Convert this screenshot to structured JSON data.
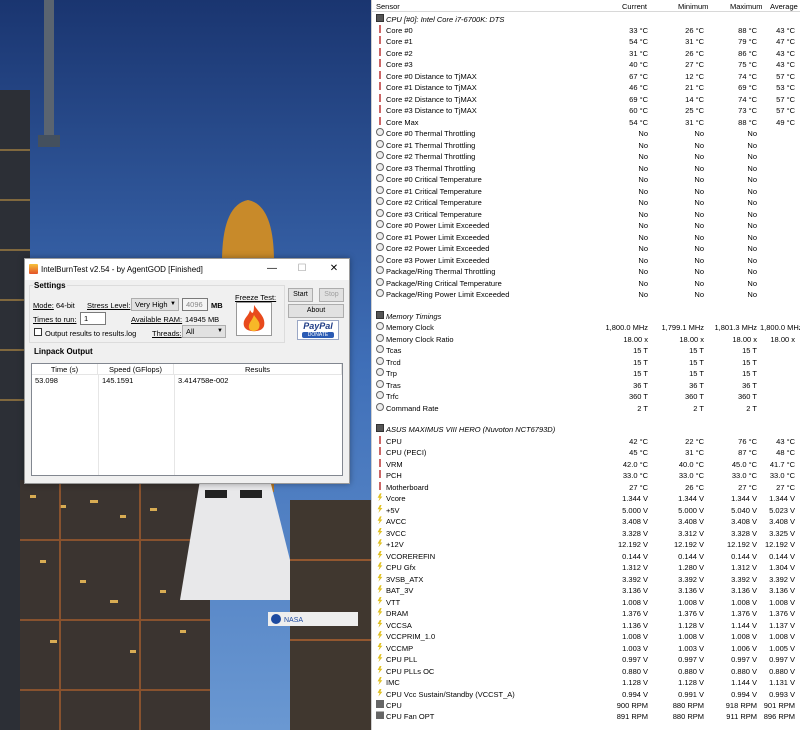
{
  "sensor_panel": {
    "headers": {
      "sensor": "Sensor",
      "current": "Current",
      "minimum": "Minimum",
      "maximum": "Maximum",
      "average": "Average"
    },
    "rows": [
      {
        "type": "group",
        "name": "CPU [#0]: Intel Core i7-6700K: DTS"
      },
      {
        "icon": "thermometer-icon",
        "name": "Core #0",
        "cur": "33 °C",
        "min": "26 °C",
        "max": "88 °C",
        "avg": "43 °C"
      },
      {
        "icon": "thermometer-icon",
        "name": "Core #1",
        "cur": "54 °C",
        "min": "31 °C",
        "max": "79 °C",
        "avg": "47 °C"
      },
      {
        "icon": "thermometer-icon",
        "name": "Core #2",
        "cur": "31 °C",
        "min": "26 °C",
        "max": "86 °C",
        "avg": "43 °C"
      },
      {
        "icon": "thermometer-icon",
        "name": "Core #3",
        "cur": "40 °C",
        "min": "27 °C",
        "max": "75 °C",
        "avg": "43 °C"
      },
      {
        "icon": "thermometer-icon",
        "name": "Core #0 Distance to TjMAX",
        "cur": "67 °C",
        "min": "12 °C",
        "max": "74 °C",
        "avg": "57 °C"
      },
      {
        "icon": "thermometer-icon",
        "name": "Core #1 Distance to TjMAX",
        "cur": "46 °C",
        "min": "21 °C",
        "max": "69 °C",
        "avg": "53 °C"
      },
      {
        "icon": "thermometer-icon",
        "name": "Core #2 Distance to TjMAX",
        "cur": "69 °C",
        "min": "14 °C",
        "max": "74 °C",
        "avg": "57 °C"
      },
      {
        "icon": "thermometer-icon",
        "name": "Core #3 Distance to TjMAX",
        "cur": "60 °C",
        "min": "25 °C",
        "max": "73 °C",
        "avg": "57 °C"
      },
      {
        "icon": "thermometer-icon",
        "name": "Core Max",
        "cur": "54 °C",
        "min": "31 °C",
        "max": "88 °C",
        "avg": "49 °C"
      },
      {
        "icon": "clock-icon",
        "name": "Core #0 Thermal Throttling",
        "cur": "No",
        "min": "No",
        "max": "No",
        "avg": ""
      },
      {
        "icon": "clock-icon",
        "name": "Core #1 Thermal Throttling",
        "cur": "No",
        "min": "No",
        "max": "No",
        "avg": ""
      },
      {
        "icon": "clock-icon",
        "name": "Core #2 Thermal Throttling",
        "cur": "No",
        "min": "No",
        "max": "No",
        "avg": ""
      },
      {
        "icon": "clock-icon",
        "name": "Core #3 Thermal Throttling",
        "cur": "No",
        "min": "No",
        "max": "No",
        "avg": ""
      },
      {
        "icon": "clock-icon",
        "name": "Core #0 Critical Temperature",
        "cur": "No",
        "min": "No",
        "max": "No",
        "avg": ""
      },
      {
        "icon": "clock-icon",
        "name": "Core #1 Critical Temperature",
        "cur": "No",
        "min": "No",
        "max": "No",
        "avg": ""
      },
      {
        "icon": "clock-icon",
        "name": "Core #2 Critical Temperature",
        "cur": "No",
        "min": "No",
        "max": "No",
        "avg": ""
      },
      {
        "icon": "clock-icon",
        "name": "Core #3 Critical Temperature",
        "cur": "No",
        "min": "No",
        "max": "No",
        "avg": ""
      },
      {
        "icon": "clock-icon",
        "name": "Core #0 Power Limit Exceeded",
        "cur": "No",
        "min": "No",
        "max": "No",
        "avg": ""
      },
      {
        "icon": "clock-icon",
        "name": "Core #1 Power Limit Exceeded",
        "cur": "No",
        "min": "No",
        "max": "No",
        "avg": ""
      },
      {
        "icon": "clock-icon",
        "name": "Core #2 Power Limit Exceeded",
        "cur": "No",
        "min": "No",
        "max": "No",
        "avg": ""
      },
      {
        "icon": "clock-icon",
        "name": "Core #3 Power Limit Exceeded",
        "cur": "No",
        "min": "No",
        "max": "No",
        "avg": ""
      },
      {
        "icon": "clock-icon",
        "name": "Package/Ring Thermal Throttling",
        "cur": "No",
        "min": "No",
        "max": "No",
        "avg": ""
      },
      {
        "icon": "clock-icon",
        "name": "Package/Ring Critical Temperature",
        "cur": "No",
        "min": "No",
        "max": "No",
        "avg": ""
      },
      {
        "icon": "clock-icon",
        "name": "Package/Ring Power Limit Exceeded",
        "cur": "No",
        "min": "No",
        "max": "No",
        "avg": ""
      },
      {
        "type": "spacer"
      },
      {
        "type": "group",
        "name": "Memory Timings"
      },
      {
        "icon": "clock-icon",
        "name": "Memory Clock",
        "cur": "1,800.0 MHz",
        "min": "1,799.1 MHz",
        "max": "1,801.3 MHz",
        "avg": "1,800.0 MHz"
      },
      {
        "icon": "clock-icon",
        "name": "Memory Clock Ratio",
        "cur": "18.00 x",
        "min": "18.00 x",
        "max": "18.00 x",
        "avg": "18.00 x"
      },
      {
        "icon": "clock-icon",
        "name": "Tcas",
        "cur": "15 T",
        "min": "15 T",
        "max": "15 T",
        "avg": ""
      },
      {
        "icon": "clock-icon",
        "name": "Trcd",
        "cur": "15 T",
        "min": "15 T",
        "max": "15 T",
        "avg": ""
      },
      {
        "icon": "clock-icon",
        "name": "Trp",
        "cur": "15 T",
        "min": "15 T",
        "max": "15 T",
        "avg": ""
      },
      {
        "icon": "clock-icon",
        "name": "Tras",
        "cur": "36 T",
        "min": "36 T",
        "max": "36 T",
        "avg": ""
      },
      {
        "icon": "clock-icon",
        "name": "Trfc",
        "cur": "360 T",
        "min": "360 T",
        "max": "360 T",
        "avg": ""
      },
      {
        "icon": "clock-icon",
        "name": "Command Rate",
        "cur": "2 T",
        "min": "2 T",
        "max": "2 T",
        "avg": ""
      },
      {
        "type": "spacer"
      },
      {
        "type": "group",
        "name": "ASUS MAXIMUS VIII HERO (Nuvoton NCT6793D)"
      },
      {
        "icon": "thermometer-icon",
        "name": "CPU",
        "cur": "42 °C",
        "min": "22 °C",
        "max": "76 °C",
        "avg": "43 °C"
      },
      {
        "icon": "thermometer-icon",
        "name": "CPU (PECI)",
        "cur": "45 °C",
        "min": "31 °C",
        "max": "87 °C",
        "avg": "48 °C"
      },
      {
        "icon": "thermometer-icon",
        "name": "VRM",
        "cur": "42.0 °C",
        "min": "40.0 °C",
        "max": "45.0 °C",
        "avg": "41.7 °C"
      },
      {
        "icon": "thermometer-icon",
        "name": "PCH",
        "cur": "33.0 °C",
        "min": "33.0 °C",
        "max": "33.0 °C",
        "avg": "33.0 °C"
      },
      {
        "icon": "thermometer-icon",
        "name": "Motherboard",
        "cur": "27 °C",
        "min": "26 °C",
        "max": "27 °C",
        "avg": "27 °C"
      },
      {
        "icon": "voltage-icon",
        "name": "Vcore",
        "cur": "1.344 V",
        "min": "1.344 V",
        "max": "1.344 V",
        "avg": "1.344 V"
      },
      {
        "icon": "voltage-icon",
        "name": "+5V",
        "cur": "5.000 V",
        "min": "5.000 V",
        "max": "5.040 V",
        "avg": "5.023 V"
      },
      {
        "icon": "voltage-icon",
        "name": "AVCC",
        "cur": "3.408 V",
        "min": "3.408 V",
        "max": "3.408 V",
        "avg": "3.408 V"
      },
      {
        "icon": "voltage-icon",
        "name": "3VCC",
        "cur": "3.328 V",
        "min": "3.312 V",
        "max": "3.328 V",
        "avg": "3.325 V"
      },
      {
        "icon": "voltage-icon",
        "name": "+12V",
        "cur": "12.192 V",
        "min": "12.192 V",
        "max": "12.192 V",
        "avg": "12.192 V"
      },
      {
        "icon": "voltage-icon",
        "name": "VCOREREFIN",
        "cur": "0.144 V",
        "min": "0.144 V",
        "max": "0.144 V",
        "avg": "0.144 V"
      },
      {
        "icon": "voltage-icon",
        "name": "CPU Gfx",
        "cur": "1.312 V",
        "min": "1.280 V",
        "max": "1.312 V",
        "avg": "1.304 V"
      },
      {
        "icon": "voltage-icon",
        "name": "3VSB_ATX",
        "cur": "3.392 V",
        "min": "3.392 V",
        "max": "3.392 V",
        "avg": "3.392 V"
      },
      {
        "icon": "voltage-icon",
        "name": "BAT_3V",
        "cur": "3.136 V",
        "min": "3.136 V",
        "max": "3.136 V",
        "avg": "3.136 V"
      },
      {
        "icon": "voltage-icon",
        "name": "VTT",
        "cur": "1.008 V",
        "min": "1.008 V",
        "max": "1.008 V",
        "avg": "1.008 V"
      },
      {
        "icon": "voltage-icon",
        "name": "DRAM",
        "cur": "1.376 V",
        "min": "1.376 V",
        "max": "1.376 V",
        "avg": "1.376 V"
      },
      {
        "icon": "voltage-icon",
        "name": "VCCSA",
        "cur": "1.136 V",
        "min": "1.128 V",
        "max": "1.144 V",
        "avg": "1.137 V"
      },
      {
        "icon": "voltage-icon",
        "name": "VCCPRIM_1.0",
        "cur": "1.008 V",
        "min": "1.008 V",
        "max": "1.008 V",
        "avg": "1.008 V"
      },
      {
        "icon": "voltage-icon",
        "name": "VCCMP",
        "cur": "1.003 V",
        "min": "1.003 V",
        "max": "1.006 V",
        "avg": "1.005 V"
      },
      {
        "icon": "voltage-icon",
        "name": "CPU PLL",
        "cur": "0.997 V",
        "min": "0.997 V",
        "max": "0.997 V",
        "avg": "0.997 V"
      },
      {
        "icon": "voltage-icon",
        "name": "CPU PLLs OC",
        "cur": "0.880 V",
        "min": "0.880 V",
        "max": "0.880 V",
        "avg": "0.880 V"
      },
      {
        "icon": "voltage-icon",
        "name": "IMC",
        "cur": "1.128 V",
        "min": "1.128 V",
        "max": "1.144 V",
        "avg": "1.131 V"
      },
      {
        "icon": "voltage-icon",
        "name": "CPU Vcc Sustain/Standby (VCCST_A)",
        "cur": "0.994 V",
        "min": "0.991 V",
        "max": "0.994 V",
        "avg": "0.993 V"
      },
      {
        "icon": "fan-icon",
        "name": "CPU",
        "cur": "900 RPM",
        "min": "880 RPM",
        "max": "918 RPM",
        "avg": "901 RPM"
      },
      {
        "icon": "fan-icon",
        "name": "CPU Fan OPT",
        "cur": "891 RPM",
        "min": "880 RPM",
        "max": "911 RPM",
        "avg": "896 RPM"
      }
    ]
  },
  "ibt": {
    "title": "IntelBurnTest v2.54 - by AgentGOD [Finished]",
    "window_controls": {
      "minimize": "—",
      "maximize": "☐",
      "close": "✕"
    },
    "settings_title": "Settings",
    "mode_label": "Mode:",
    "mode_value": "64-bit",
    "stress_label": "Stress Level:",
    "stress_value": "Very High",
    "stress_mb_value": "4096",
    "mb_unit": "MB",
    "times_label": "Times to run:",
    "times_value": "1",
    "ram_label": "Available RAM:",
    "ram_value": "14945 MB",
    "output_checkbox_label": "Output results to results.log",
    "threads_label": "Threads:",
    "threads_value": "All",
    "freeze_label": "Freeze Test:",
    "start_label": "Start",
    "stop_label": "Stop",
    "about_label": "About",
    "paypal_label": "PayPal",
    "donate_label": "DONATE",
    "output_title": "Linpack Output",
    "columns": [
      "Time (s)",
      "Speed (GFlops)",
      "Results"
    ],
    "results": [
      {
        "time": "53.098",
        "speed": "145.1591",
        "result": "3.414758e-002"
      }
    ]
  },
  "desktop": {
    "wallpaper_sign_text": "NASA"
  }
}
